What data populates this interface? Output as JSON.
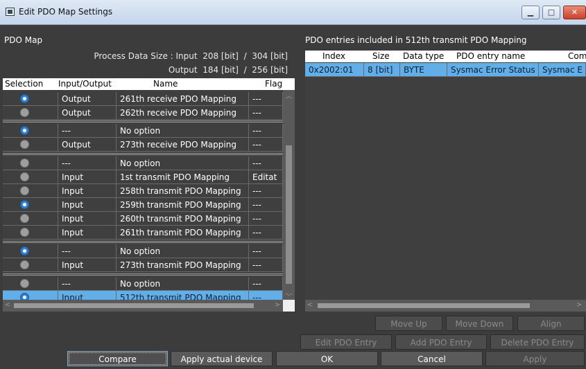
{
  "window": {
    "title": "Edit PDO Map Settings"
  },
  "pdo_map": {
    "title": "PDO Map",
    "process_data_input": "Process Data Size : Input  208 [bit]  /  304 [bit]",
    "process_data_output": "Output  184 [bit]  /  256 [bit]",
    "columns": [
      "Selection",
      "Input/Output",
      "Name",
      "Flag"
    ],
    "rows": [
      {
        "selected": true,
        "io": "Output",
        "name": "261th receive PDO Mapping",
        "flag": "---"
      },
      {
        "selected": false,
        "io": "Output",
        "name": "262th receive PDO Mapping",
        "flag": "---"
      },
      {
        "selected": true,
        "io": "---",
        "name": "No option",
        "flag": "---"
      },
      {
        "selected": false,
        "io": "Output",
        "name": "273th receive PDO Mapping",
        "flag": "---"
      },
      {
        "selected": false,
        "io": "---",
        "name": "No option",
        "flag": "---"
      },
      {
        "selected": false,
        "io": "Input",
        "name": "1st transmit PDO Mapping",
        "flag": "Editat"
      },
      {
        "selected": false,
        "io": "Input",
        "name": "258th transmit PDO Mapping",
        "flag": "---"
      },
      {
        "selected": true,
        "io": "Input",
        "name": "259th transmit PDO Mapping",
        "flag": "---"
      },
      {
        "selected": false,
        "io": "Input",
        "name": "260th transmit PDO Mapping",
        "flag": "---"
      },
      {
        "selected": false,
        "io": "Input",
        "name": "261th transmit PDO Mapping",
        "flag": "---"
      },
      {
        "selected": true,
        "io": "---",
        "name": "No option",
        "flag": "---"
      },
      {
        "selected": false,
        "io": "Input",
        "name": "273th transmit PDO Mapping",
        "flag": "---"
      },
      {
        "selected": false,
        "io": "---",
        "name": "No option",
        "flag": "---"
      },
      {
        "selected": true,
        "io": "Input",
        "name": "512th transmit PDO Mapping",
        "flag": "---",
        "highlight": true
      }
    ]
  },
  "pdo_entries": {
    "title": "PDO entries included in 512th transmit PDO Mapping",
    "columns": [
      "Index",
      "Size",
      "Data type",
      "PDO entry name",
      "Com"
    ],
    "rows": [
      {
        "index": "0x2002:01",
        "size": "8 [bit]",
        "type": "BYTE",
        "name": "Sysmac Error Status",
        "comment": "Sysmac E"
      }
    ]
  },
  "buttons": {
    "move_up": "Move Up",
    "move_down": "Move Down",
    "align": "Align",
    "edit_entry": "Edit PDO Entry",
    "add_entry": "Add PDO Entry",
    "delete_entry": "Delete PDO Entry",
    "compare": "Compare",
    "apply_actual": "Apply actual device",
    "ok": "OK",
    "cancel": "Cancel",
    "apply": "Apply"
  },
  "colors": {
    "background": "#3c3c3c",
    "selected_row": "#62aee8",
    "radio_on": "#2f7fd0"
  }
}
